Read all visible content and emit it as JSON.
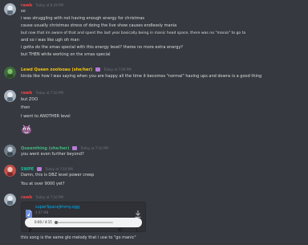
{
  "messages": [
    {
      "username": "rawb",
      "user_color": "#f04747",
      "timestamp": "Today at 6:29 PM",
      "lines": [
        "so",
        "i was struggling with not having enough energy for christmas",
        "cause usually christmas stress of doing the live show causes endlessly mania",
        "but now that im aware of that and spent the last year basically being in manic head space, there was no \"mania\" to go to",
        "and so i was like ugh oh man",
        "i gotta do the xmas special with this energy level? theres no more extra energy?",
        "but THEN while working on the xmas special"
      ]
    },
    {
      "username": "Lewd Queen zoolooau (she/her)",
      "user_color": "#f1c40f",
      "timestamp": "Today at 7:09 PM",
      "lines": [
        "kinda like how I was saying when you are happy all the time it becomes \"normal\" having ups and downs is a good thing"
      ]
    },
    {
      "username": "rawb",
      "user_color": "#f04747",
      "timestamp": "Today at 7:10 PM",
      "lines": [
        "but ZOO",
        "then",
        "I went to ANOTHER level"
      ]
    },
    {
      "username": "Queenthing (she/her)",
      "user_color": "#43b581",
      "timestamp": "Today at 7:10 PM",
      "lines": [
        "you went even further beyond?"
      ]
    },
    {
      "username": "SWPE",
      "user_color": "#1abc9c",
      "timestamp": "Today at 7:10 PM",
      "lines": [
        "Damn, this is DBZ level power creep",
        "You at over 9000 yet?"
      ]
    },
    {
      "username": "rawb",
      "user_color": "#f04747",
      "timestamp": "Today at 7:10 PM",
      "lines": [
        "this song is the same glo melody that i use to \"go manic\""
      ],
      "attachment": {
        "filename": "superSpaceJimmy.ogg",
        "filesize": "4.07 MB",
        "player_time": "0:00 / 4:15"
      }
    }
  ],
  "colors": {
    "background": "#36393f",
    "text": "#dcddde",
    "timestamp": "#72767d",
    "link": "#00aff4"
  },
  "icons": {
    "file": "audio-file-icon",
    "download": "download-icon",
    "play": "play-icon",
    "volume": "volume-icon",
    "more": "more-options-icon",
    "badge": "role-badge-icon",
    "emoji": "sticker-emoji"
  }
}
